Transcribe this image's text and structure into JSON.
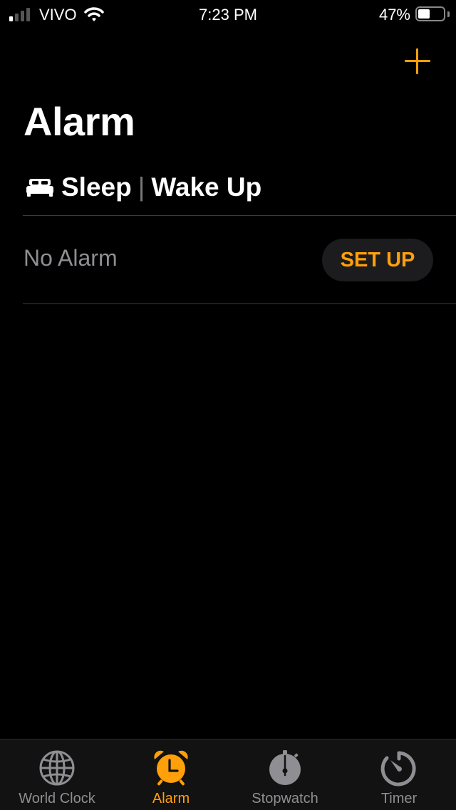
{
  "status_bar": {
    "carrier": "VIVO",
    "time": "7:23 PM",
    "battery_percent_label": "47%",
    "battery_level": 0.47,
    "signal_bars_active": 1,
    "signal_bars_total": 4
  },
  "header": {
    "title": "Alarm",
    "add_icon": "plus-icon"
  },
  "sleep_section": {
    "icon": "bed-icon",
    "label_sleep": "Sleep",
    "separator": "|",
    "label_wake": "Wake Up",
    "status": "No Alarm",
    "button_label": "SET UP"
  },
  "tabs": [
    {
      "label": "World Clock",
      "icon": "globe-icon",
      "active": false
    },
    {
      "label": "Alarm",
      "icon": "alarm-clock-icon",
      "active": true
    },
    {
      "label": "Stopwatch",
      "icon": "stopwatch-icon",
      "active": false
    },
    {
      "label": "Timer",
      "icon": "timer-icon",
      "active": false
    }
  ],
  "colors": {
    "accent": "#ff9f0a",
    "background": "#000000",
    "inactive": "#8e8e93",
    "button_bg": "#1c1c1e",
    "tabbar_bg": "#121212"
  }
}
